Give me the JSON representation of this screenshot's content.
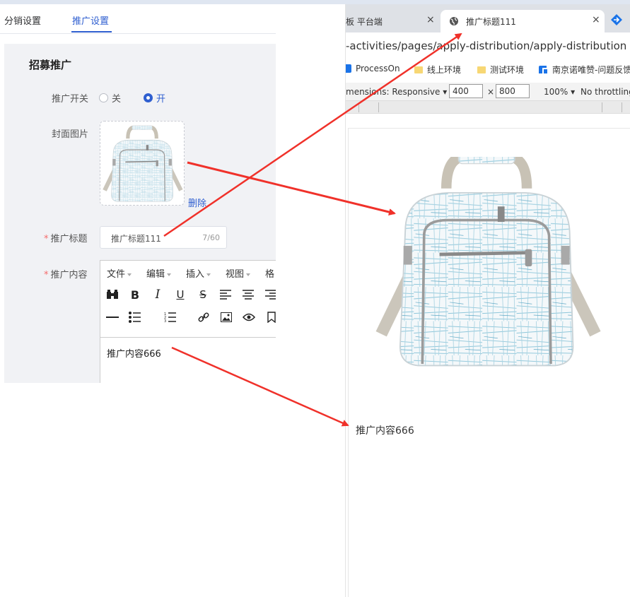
{
  "admin": {
    "tabs": [
      {
        "label": "分销设置"
      },
      {
        "label": "推广设置"
      }
    ],
    "section_title": "招募推广",
    "switch": {
      "label": "推广开关",
      "options": [
        {
          "label": "关"
        },
        {
          "label": "开"
        }
      ],
      "selected": "开"
    },
    "cover": {
      "label": "封面图片",
      "delete_label": "删除"
    },
    "title_field": {
      "label": "推广标题",
      "value": "推广标题111",
      "counter": "7/60"
    },
    "content_field": {
      "label": "推广内容",
      "menus": [
        {
          "label": "文件"
        },
        {
          "label": "编辑"
        },
        {
          "label": "插入"
        },
        {
          "label": "视图"
        },
        {
          "label": "格"
        }
      ],
      "content": "推广内容666"
    },
    "colors": {
      "accent": "#2f5fd0",
      "required": "#f56c6c",
      "panel": "#f1f2f5"
    }
  },
  "browser": {
    "inactive_tab": {
      "title": "板 平台端",
      "close": "×"
    },
    "active_tab": {
      "title": "推广标题111",
      "close": "×"
    },
    "url": "-activities/pages/apply-distribution/apply-distribution",
    "bookmarks": [
      {
        "label": "ProcessOn"
      },
      {
        "label": "线上环境"
      },
      {
        "label": "测试环境"
      },
      {
        "label": "南京诺唯赞-问题反馈"
      }
    ],
    "devtools": {
      "dimensions_label": "mensions: Responsive",
      "width": "400",
      "times": "×",
      "height": "800",
      "zoom": "100%",
      "throttling": "No throttling"
    },
    "preview_content": "推广内容666"
  },
  "annotation_color": "#f0312a"
}
